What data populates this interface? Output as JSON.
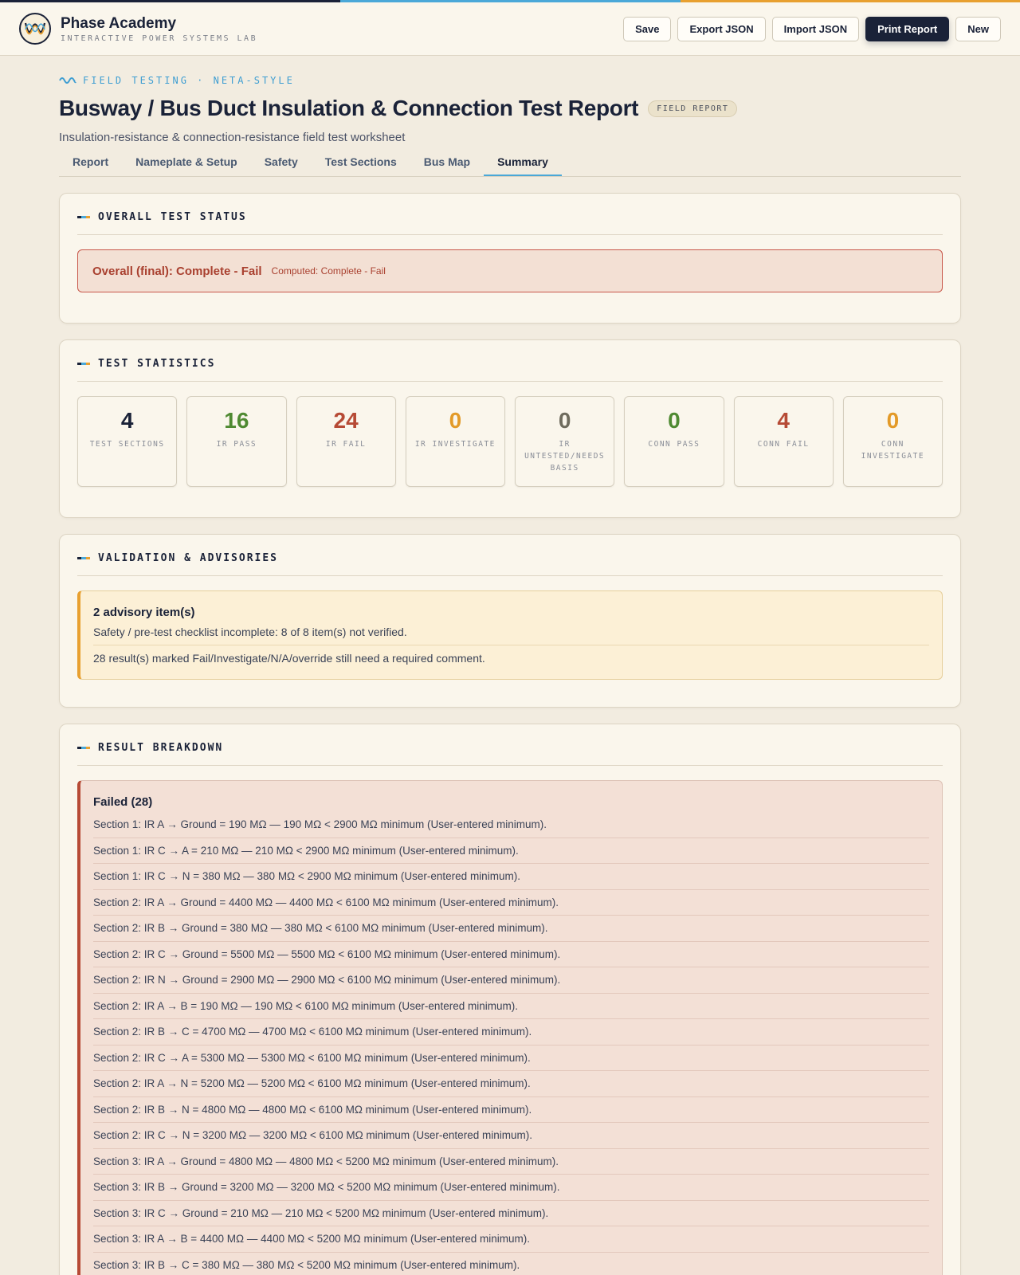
{
  "brand": {
    "name": "Phase Academy",
    "tagline": "INTERACTIVE POWER SYSTEMS LAB"
  },
  "toolbar": {
    "save": "Save",
    "export_json": "Export JSON",
    "import_json": "Import JSON",
    "print_report": "Print Report",
    "new": "New"
  },
  "header": {
    "eyebrow": "FIELD TESTING · NETA-STYLE",
    "title": "Busway / Bus Duct Insulation & Connection Test Report",
    "badge": "FIELD REPORT",
    "subtitle": "Insulation-resistance & connection-resistance field test worksheet"
  },
  "tabs": [
    "Report",
    "Nameplate & Setup",
    "Safety",
    "Test Sections",
    "Bus Map",
    "Summary"
  ],
  "active_tab": "Summary",
  "overall": {
    "heading": "OVERALL TEST STATUS",
    "final": "Overall (final): Complete - Fail",
    "computed": "Computed: Complete - Fail"
  },
  "statistics": {
    "heading": "TEST STATISTICS",
    "items": [
      {
        "value": "4",
        "label": "TEST SECTIONS",
        "color": "#1a2238"
      },
      {
        "value": "16",
        "label": "IR PASS",
        "color": "#4f8a32"
      },
      {
        "value": "24",
        "label": "IR FAIL",
        "color": "#b64a35"
      },
      {
        "value": "0",
        "label": "IR INVESTIGATE",
        "color": "#e39a28"
      },
      {
        "value": "0",
        "label": "IR UNTESTED/NEEDS BASIS",
        "color": "#6f6c5e"
      },
      {
        "value": "0",
        "label": "CONN PASS",
        "color": "#4f8a32"
      },
      {
        "value": "4",
        "label": "CONN FAIL",
        "color": "#b64a35"
      },
      {
        "value": "0",
        "label": "CONN INVESTIGATE",
        "color": "#e39a28"
      }
    ]
  },
  "validation": {
    "heading": "VALIDATION & ADVISORIES",
    "title": "2 advisory item(s)",
    "items": [
      "Safety / pre-test checklist incomplete: 8 of 8 item(s) not verified.",
      "28 result(s) marked Fail/Investigate/N/A/override still need a required comment."
    ]
  },
  "breakdown": {
    "heading": "RESULT BREAKDOWN",
    "failed_title": "Failed (28)",
    "failed": [
      "Section 1: IR A → Ground = 190 MΩ — 190 MΩ < 2900 MΩ minimum (User-entered minimum).",
      "Section 1: IR C → A = 210 MΩ — 210 MΩ < 2900 MΩ minimum (User-entered minimum).",
      "Section 1: IR C → N = 380 MΩ — 380 MΩ < 2900 MΩ minimum (User-entered minimum).",
      "Section 2: IR A → Ground = 4400 MΩ — 4400 MΩ < 6100 MΩ minimum (User-entered minimum).",
      "Section 2: IR B → Ground = 380 MΩ — 380 MΩ < 6100 MΩ minimum (User-entered minimum).",
      "Section 2: IR C → Ground = 5500 MΩ — 5500 MΩ < 6100 MΩ minimum (User-entered minimum).",
      "Section 2: IR N → Ground = 2900 MΩ — 2900 MΩ < 6100 MΩ minimum (User-entered minimum).",
      "Section 2: IR A → B = 190 MΩ — 190 MΩ < 6100 MΩ minimum (User-entered minimum).",
      "Section 2: IR B → C = 4700 MΩ — 4700 MΩ < 6100 MΩ minimum (User-entered minimum).",
      "Section 2: IR C → A = 5300 MΩ — 5300 MΩ < 6100 MΩ minimum (User-entered minimum).",
      "Section 2: IR A → N = 5200 MΩ — 5200 MΩ < 6100 MΩ minimum (User-entered minimum).",
      "Section 2: IR B → N = 4800 MΩ — 4800 MΩ < 6100 MΩ minimum (User-entered minimum).",
      "Section 2: IR C → N = 3200 MΩ — 3200 MΩ < 6100 MΩ minimum (User-entered minimum).",
      "Section 3: IR A → Ground = 4800 MΩ — 4800 MΩ < 5200 MΩ minimum (User-entered minimum).",
      "Section 3: IR B → Ground = 3200 MΩ — 3200 MΩ < 5200 MΩ minimum (User-entered minimum).",
      "Section 3: IR C → Ground = 210 MΩ — 210 MΩ < 5200 MΩ minimum (User-entered minimum).",
      "Section 3: IR A → B = 4400 MΩ — 4400 MΩ < 5200 MΩ minimum (User-entered minimum).",
      "Section 3: IR B → C = 380 MΩ — 380 MΩ < 5200 MΩ minimum (User-entered minimum)."
    ]
  },
  "colors": {
    "navy": "#1a2238",
    "accent_blue": "#4aa8d8",
    "accent_amber": "#e8a030",
    "fail_red": "#b64a35",
    "pass_green": "#4f8a32"
  }
}
